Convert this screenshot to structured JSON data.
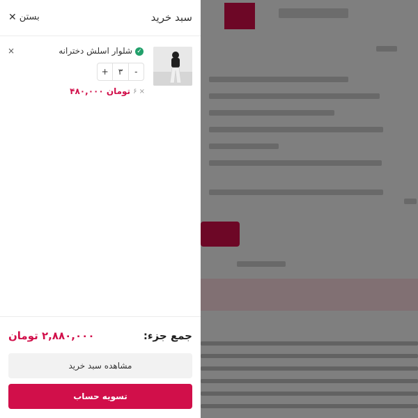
{
  "cart": {
    "title": "سبد خرید",
    "close_label": "بستن",
    "close_icon": "close-icon"
  },
  "item": {
    "name": "شلوار اسلش دخترانه",
    "quantity": "۳",
    "minus": "-",
    "plus": "+",
    "count_text": "۶ ×",
    "price_text": "۴۸۰,۰۰۰ تومان",
    "remove_icon": "×",
    "check_icon": "✓"
  },
  "footer": {
    "subtotal_label": "جمع جزء:",
    "subtotal_value": "۲,۸۸۰,۰۰۰ تومان",
    "view_cart_label": "مشاهده سبد خرید",
    "checkout_label": "تسویه حساب"
  },
  "colors": {
    "accent": "#d10f4a",
    "success": "#22a06b"
  }
}
